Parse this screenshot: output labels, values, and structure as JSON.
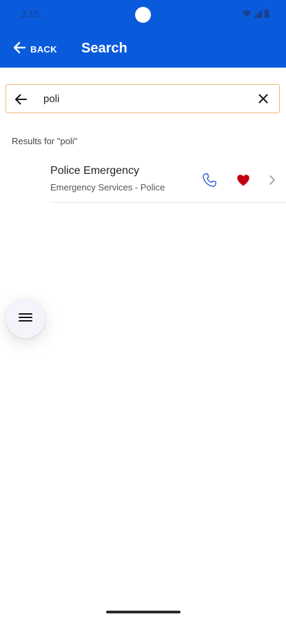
{
  "status_bar": {
    "time": "2:15",
    "icons": [
      "wifi-icon",
      "signal-icon",
      "battery-icon"
    ]
  },
  "app_bar": {
    "back_label": "BACK",
    "title": "Search",
    "background_color": "#0a5bdc"
  },
  "search": {
    "value": "poli",
    "placeholder": "",
    "border_color": "#f1b678"
  },
  "results": {
    "heading": "Results for \"poli\"",
    "items": [
      {
        "title": "Police Emergency",
        "subtitle": "Emergency Services - Police",
        "favorite": true,
        "icons": [
          "phone-icon",
          "heart-icon",
          "chevron-right-icon"
        ]
      }
    ]
  },
  "fab": {
    "icon": "menu-icon"
  },
  "colors": {
    "accent": "#0a5bdc",
    "call_icon": "#2f5fd0",
    "favorite_icon": "#c30012"
  }
}
